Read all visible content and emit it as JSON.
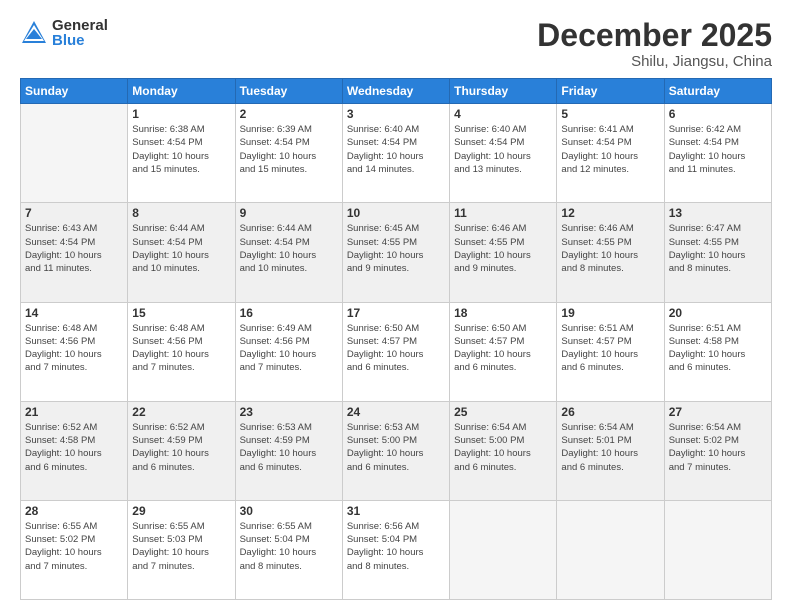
{
  "header": {
    "logo_general": "General",
    "logo_blue": "Blue",
    "month_title": "December 2025",
    "location": "Shilu, Jiangsu, China"
  },
  "weekdays": [
    "Sunday",
    "Monday",
    "Tuesday",
    "Wednesday",
    "Thursday",
    "Friday",
    "Saturday"
  ],
  "weeks": [
    [
      {
        "day": "",
        "info": ""
      },
      {
        "day": "1",
        "info": "Sunrise: 6:38 AM\nSunset: 4:54 PM\nDaylight: 10 hours\nand 15 minutes."
      },
      {
        "day": "2",
        "info": "Sunrise: 6:39 AM\nSunset: 4:54 PM\nDaylight: 10 hours\nand 15 minutes."
      },
      {
        "day": "3",
        "info": "Sunrise: 6:40 AM\nSunset: 4:54 PM\nDaylight: 10 hours\nand 14 minutes."
      },
      {
        "day": "4",
        "info": "Sunrise: 6:40 AM\nSunset: 4:54 PM\nDaylight: 10 hours\nand 13 minutes."
      },
      {
        "day": "5",
        "info": "Sunrise: 6:41 AM\nSunset: 4:54 PM\nDaylight: 10 hours\nand 12 minutes."
      },
      {
        "day": "6",
        "info": "Sunrise: 6:42 AM\nSunset: 4:54 PM\nDaylight: 10 hours\nand 11 minutes."
      }
    ],
    [
      {
        "day": "7",
        "info": "Sunrise: 6:43 AM\nSunset: 4:54 PM\nDaylight: 10 hours\nand 11 minutes."
      },
      {
        "day": "8",
        "info": "Sunrise: 6:44 AM\nSunset: 4:54 PM\nDaylight: 10 hours\nand 10 minutes."
      },
      {
        "day": "9",
        "info": "Sunrise: 6:44 AM\nSunset: 4:54 PM\nDaylight: 10 hours\nand 10 minutes."
      },
      {
        "day": "10",
        "info": "Sunrise: 6:45 AM\nSunset: 4:55 PM\nDaylight: 10 hours\nand 9 minutes."
      },
      {
        "day": "11",
        "info": "Sunrise: 6:46 AM\nSunset: 4:55 PM\nDaylight: 10 hours\nand 9 minutes."
      },
      {
        "day": "12",
        "info": "Sunrise: 6:46 AM\nSunset: 4:55 PM\nDaylight: 10 hours\nand 8 minutes."
      },
      {
        "day": "13",
        "info": "Sunrise: 6:47 AM\nSunset: 4:55 PM\nDaylight: 10 hours\nand 8 minutes."
      }
    ],
    [
      {
        "day": "14",
        "info": "Sunrise: 6:48 AM\nSunset: 4:56 PM\nDaylight: 10 hours\nand 7 minutes."
      },
      {
        "day": "15",
        "info": "Sunrise: 6:48 AM\nSunset: 4:56 PM\nDaylight: 10 hours\nand 7 minutes."
      },
      {
        "day": "16",
        "info": "Sunrise: 6:49 AM\nSunset: 4:56 PM\nDaylight: 10 hours\nand 7 minutes."
      },
      {
        "day": "17",
        "info": "Sunrise: 6:50 AM\nSunset: 4:57 PM\nDaylight: 10 hours\nand 6 minutes."
      },
      {
        "day": "18",
        "info": "Sunrise: 6:50 AM\nSunset: 4:57 PM\nDaylight: 10 hours\nand 6 minutes."
      },
      {
        "day": "19",
        "info": "Sunrise: 6:51 AM\nSunset: 4:57 PM\nDaylight: 10 hours\nand 6 minutes."
      },
      {
        "day": "20",
        "info": "Sunrise: 6:51 AM\nSunset: 4:58 PM\nDaylight: 10 hours\nand 6 minutes."
      }
    ],
    [
      {
        "day": "21",
        "info": "Sunrise: 6:52 AM\nSunset: 4:58 PM\nDaylight: 10 hours\nand 6 minutes."
      },
      {
        "day": "22",
        "info": "Sunrise: 6:52 AM\nSunset: 4:59 PM\nDaylight: 10 hours\nand 6 minutes."
      },
      {
        "day": "23",
        "info": "Sunrise: 6:53 AM\nSunset: 4:59 PM\nDaylight: 10 hours\nand 6 minutes."
      },
      {
        "day": "24",
        "info": "Sunrise: 6:53 AM\nSunset: 5:00 PM\nDaylight: 10 hours\nand 6 minutes."
      },
      {
        "day": "25",
        "info": "Sunrise: 6:54 AM\nSunset: 5:00 PM\nDaylight: 10 hours\nand 6 minutes."
      },
      {
        "day": "26",
        "info": "Sunrise: 6:54 AM\nSunset: 5:01 PM\nDaylight: 10 hours\nand 6 minutes."
      },
      {
        "day": "27",
        "info": "Sunrise: 6:54 AM\nSunset: 5:02 PM\nDaylight: 10 hours\nand 7 minutes."
      }
    ],
    [
      {
        "day": "28",
        "info": "Sunrise: 6:55 AM\nSunset: 5:02 PM\nDaylight: 10 hours\nand 7 minutes."
      },
      {
        "day": "29",
        "info": "Sunrise: 6:55 AM\nSunset: 5:03 PM\nDaylight: 10 hours\nand 7 minutes."
      },
      {
        "day": "30",
        "info": "Sunrise: 6:55 AM\nSunset: 5:04 PM\nDaylight: 10 hours\nand 8 minutes."
      },
      {
        "day": "31",
        "info": "Sunrise: 6:56 AM\nSunset: 5:04 PM\nDaylight: 10 hours\nand 8 minutes."
      },
      {
        "day": "",
        "info": ""
      },
      {
        "day": "",
        "info": ""
      },
      {
        "day": "",
        "info": ""
      }
    ]
  ]
}
